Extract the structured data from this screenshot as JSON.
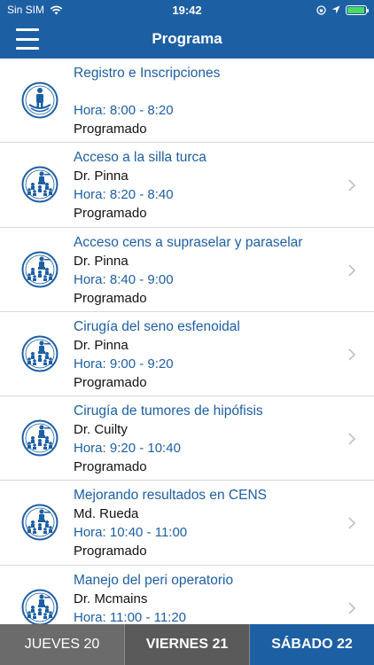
{
  "status_bar": {
    "carrier": "Sin SIM",
    "time": "19:42",
    "battery_level_percent": 95
  },
  "nav": {
    "title": "Programa"
  },
  "sessions": [
    {
      "title": "Registro e Inscripciones",
      "speaker": "",
      "time": "Hora: 8:00 - 8:20",
      "status": "Programado",
      "icon": "registration-icon",
      "has_chevron": false
    },
    {
      "title": "Acceso a la silla turca",
      "speaker": "Dr. Pinna",
      "time": "Hora: 8:20 - 8:40",
      "status": "Programado",
      "icon": "lecture-icon",
      "has_chevron": true
    },
    {
      "title": "Acceso cens a supraselar y paraselar",
      "speaker": "Dr. Pinna",
      "time": "Hora: 8:40 - 9:00",
      "status": "Programado",
      "icon": "lecture-icon",
      "has_chevron": true
    },
    {
      "title": "Cirugía del seno esfenoidal",
      "speaker": "Dr. Pinna",
      "time": "Hora: 9:00 - 9:20",
      "status": "Programado",
      "icon": "lecture-icon",
      "has_chevron": true
    },
    {
      "title": "Cirugía de tumores de hipófisis",
      "speaker": "Dr. Cuilty",
      "time": "Hora: 9:20 - 10:40",
      "status": "Programado",
      "icon": "lecture-icon",
      "has_chevron": true
    },
    {
      "title": "Mejorando resultados en CENS",
      "speaker": "Md. Rueda",
      "time": "Hora: 10:40 - 11:00",
      "status": "Programado",
      "icon": "lecture-icon",
      "has_chevron": true
    },
    {
      "title": "Manejo del peri operatorio",
      "speaker": "Dr. Mcmains",
      "time": "Hora: 11:00 - 11:20",
      "status": "",
      "icon": "lecture-icon",
      "has_chevron": true
    }
  ],
  "day_tabs": [
    {
      "label": "JUEVES 20",
      "state": "normal"
    },
    {
      "label": "VIERNES 21",
      "state": "middle"
    },
    {
      "label": "SÁBADO 22",
      "state": "active"
    }
  ],
  "colors": {
    "brand": "#1d5fa3",
    "tab_inactive": "#6b6b6b",
    "tab_selected": "#1d5fa3"
  }
}
